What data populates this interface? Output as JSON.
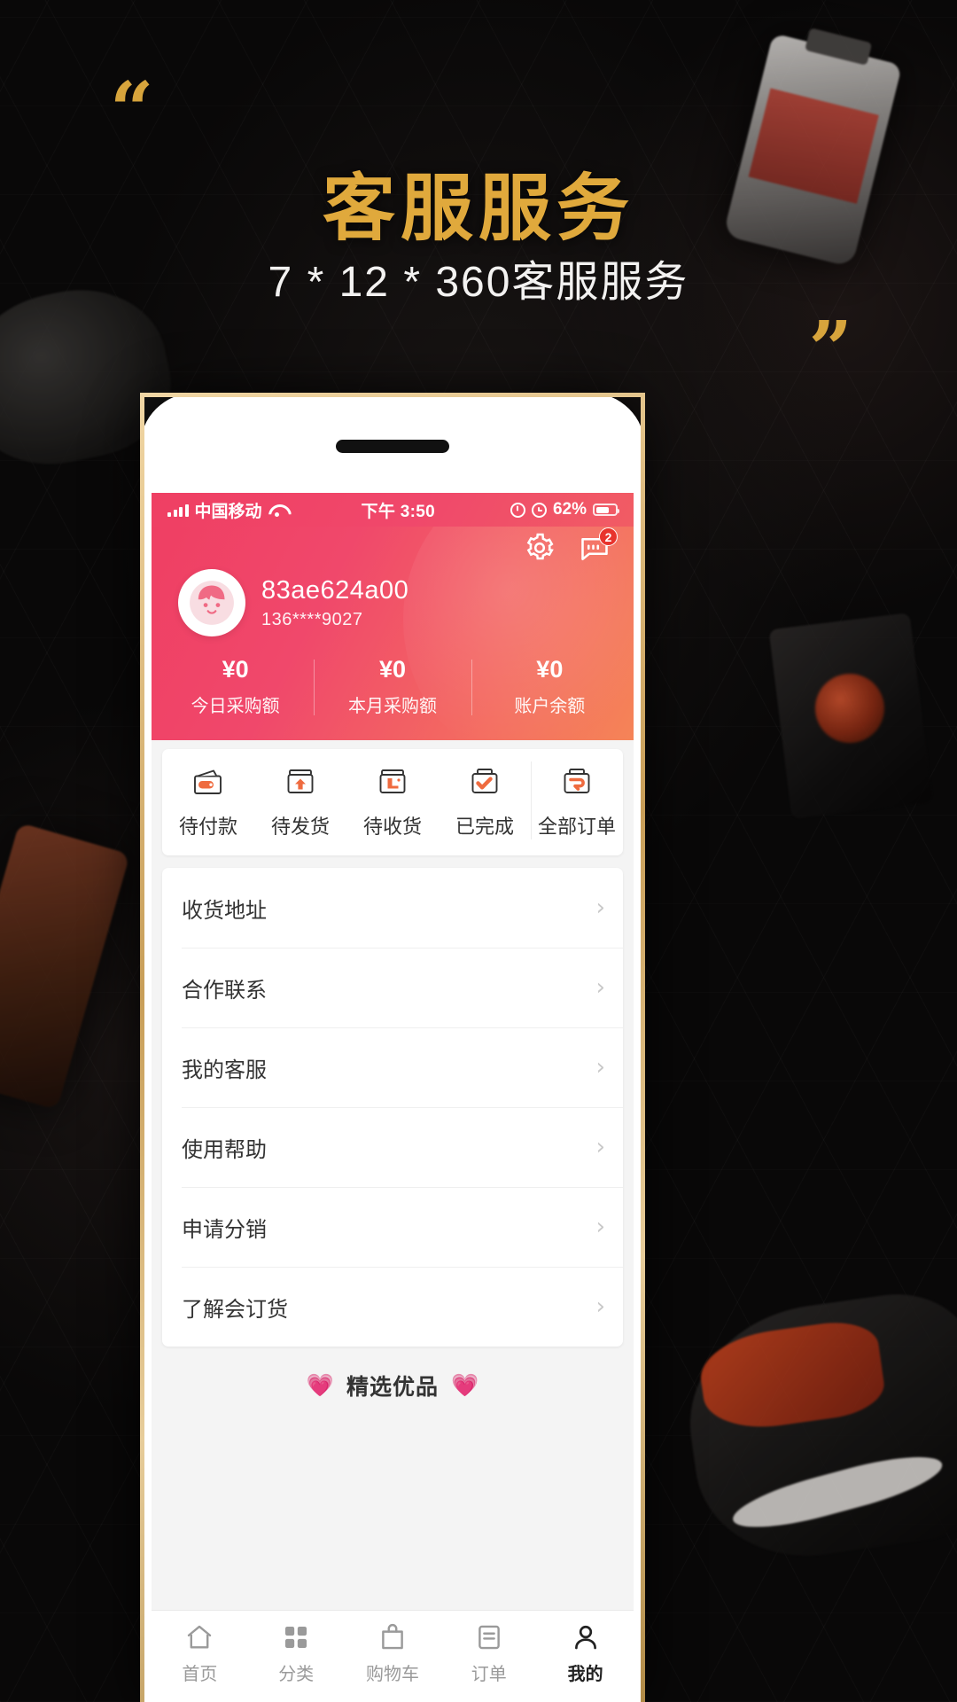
{
  "promo": {
    "title": "客服服务",
    "subtitle": "7 * 12 * 360客服服务",
    "quote_open": "“",
    "quote_close": "”",
    "title_color": "#e0a93c",
    "background_color": "#090808"
  },
  "statusbar": {
    "carrier": "中国移动",
    "time": "下午 3:50",
    "battery_percent": "62%",
    "signal_icon": "signal-bars-icon",
    "wifi_icon": "wifi-icon",
    "lock_icon": "rotation-lock-icon",
    "alarm_icon": "alarm-clock-icon",
    "battery_icon": "battery-icon"
  },
  "header": {
    "accent_color": "#ef3f63",
    "settings_icon": "gear-icon",
    "message_icon": "chat-bubble-icon",
    "message_badge": "2",
    "avatar_icon": "user-avatar-icon",
    "user_name": "83ae624a00",
    "user_phone": "136****9027",
    "stats": [
      {
        "value": "¥0",
        "label": "今日采购额"
      },
      {
        "value": "¥0",
        "label": "本月采购额"
      },
      {
        "value": "¥0",
        "label": "账户余额"
      }
    ]
  },
  "orders": {
    "tabs": [
      {
        "label": "待付款",
        "icon": "wallet-icon"
      },
      {
        "label": "待发货",
        "icon": "box-up-arrow-icon"
      },
      {
        "label": "待收货",
        "icon": "box-truck-icon"
      },
      {
        "label": "已完成",
        "icon": "box-check-icon"
      }
    ],
    "all_orders": {
      "label": "全部订单",
      "icon": "box-all-icon"
    }
  },
  "menu": {
    "items": [
      {
        "label": "收货地址",
        "chevron": "›"
      },
      {
        "label": "合作联系",
        "chevron": "›"
      },
      {
        "label": "我的客服",
        "chevron": "›"
      },
      {
        "label": "使用帮助",
        "chevron": "›"
      },
      {
        "label": "申请分销",
        "chevron": "›"
      },
      {
        "label": "了解会订货",
        "chevron": "›"
      }
    ]
  },
  "featured": {
    "label": "精选优品",
    "heart_left": "💗",
    "heart_right": "💗"
  },
  "tabbar": {
    "items": [
      {
        "label": "首页",
        "icon": "home-icon",
        "active": false
      },
      {
        "label": "分类",
        "icon": "grid-icon",
        "active": false
      },
      {
        "label": "购物车",
        "icon": "cart-icon",
        "active": false
      },
      {
        "label": "订单",
        "icon": "list-icon",
        "active": false
      },
      {
        "label": "我的",
        "icon": "person-icon",
        "active": true
      }
    ]
  }
}
